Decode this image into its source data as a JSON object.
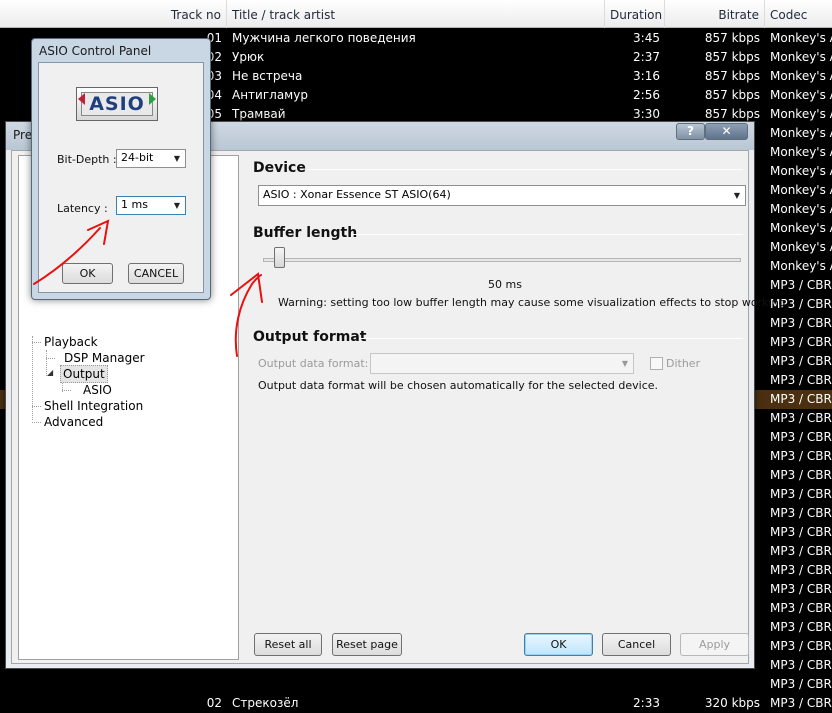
{
  "playlist": {
    "columns": [
      "Track no",
      "Title / track artist",
      "Duration",
      "Bitrate",
      "Codec"
    ],
    "rows": [
      {
        "track": "01",
        "title": "Мужчина легкого поведения",
        "duration": "3:45",
        "bitrate": "857 kbps",
        "codec": "Monkey's A"
      },
      {
        "track": "02",
        "title": "Урюк",
        "duration": "2:37",
        "bitrate": "857 kbps",
        "codec": "Monkey's A"
      },
      {
        "track": "03",
        "title": "Не встреча",
        "duration": "3:16",
        "bitrate": "857 kbps",
        "codec": "Monkey's A"
      },
      {
        "track": "04",
        "title": "Антигламур",
        "duration": "2:56",
        "bitrate": "857 kbps",
        "codec": "Monkey's A"
      },
      {
        "track": "05",
        "title": "Трамвай",
        "duration": "3:30",
        "bitrate": "857 kbps",
        "codec": "Monkey's A"
      },
      {
        "track": "",
        "title": "",
        "duration": "",
        "bitrate": "",
        "codec": "Monkey's A"
      },
      {
        "track": "",
        "title": "",
        "duration": "",
        "bitrate": "",
        "codec": "Monkey's A"
      },
      {
        "track": "",
        "title": "",
        "duration": "",
        "bitrate": "",
        "codec": "Monkey's A"
      },
      {
        "track": "",
        "title": "",
        "duration": "",
        "bitrate": "",
        "codec": "Monkey's A"
      },
      {
        "track": "",
        "title": "",
        "duration": "",
        "bitrate": "",
        "codec": "Monkey's A"
      },
      {
        "track": "",
        "title": "",
        "duration": "",
        "bitrate": "",
        "codec": "Monkey's A"
      },
      {
        "track": "",
        "title": "",
        "duration": "",
        "bitrate": "",
        "codec": "Monkey's A"
      },
      {
        "track": "",
        "title": "",
        "duration": "",
        "bitrate": "",
        "codec": "Monkey's A"
      },
      {
        "track": "",
        "title": "",
        "duration": "",
        "bitrate": "",
        "codec": "MP3 / CBR"
      },
      {
        "track": "",
        "title": "",
        "duration": "",
        "bitrate": "",
        "codec": "MP3 / CBR"
      },
      {
        "track": "",
        "title": "",
        "duration": "",
        "bitrate": "",
        "codec": "MP3 / CBR"
      },
      {
        "track": "",
        "title": "",
        "duration": "",
        "bitrate": "",
        "codec": "MP3 / CBR"
      },
      {
        "track": "",
        "title": "",
        "duration": "",
        "bitrate": "",
        "codec": "MP3 / CBR"
      },
      {
        "track": "",
        "title": "",
        "duration": "",
        "bitrate": "",
        "codec": "MP3 / CBR"
      },
      {
        "track": "",
        "title": "",
        "duration": "",
        "bitrate": "",
        "codec": "MP3 / CBR"
      },
      {
        "track": "",
        "title": "",
        "duration": "",
        "bitrate": "",
        "codec": "MP3 / CBR"
      },
      {
        "track": "",
        "title": "",
        "duration": "",
        "bitrate": "",
        "codec": "MP3 / CBR"
      },
      {
        "track": "",
        "title": "",
        "duration": "",
        "bitrate": "",
        "codec": "MP3 / CBR"
      },
      {
        "track": "",
        "title": "",
        "duration": "",
        "bitrate": "",
        "codec": "MP3 / CBR"
      },
      {
        "track": "",
        "title": "",
        "duration": "",
        "bitrate": "",
        "codec": "MP3 / CBR"
      },
      {
        "track": "",
        "title": "",
        "duration": "",
        "bitrate": "",
        "codec": "MP3 / CBR"
      },
      {
        "track": "",
        "title": "",
        "duration": "",
        "bitrate": "",
        "codec": "MP3 / CBR"
      },
      {
        "track": "",
        "title": "",
        "duration": "",
        "bitrate": "",
        "codec": "MP3 / CBR"
      },
      {
        "track": "",
        "title": "",
        "duration": "",
        "bitrate": "",
        "codec": "MP3 / CBR"
      },
      {
        "track": "",
        "title": "",
        "duration": "",
        "bitrate": "",
        "codec": "MP3 / CBR"
      },
      {
        "track": "",
        "title": "",
        "duration": "",
        "bitrate": "",
        "codec": "MP3 / CBR"
      },
      {
        "track": "",
        "title": "",
        "duration": "",
        "bitrate": "",
        "codec": "MP3 / CBR"
      },
      {
        "track": "",
        "title": "",
        "duration": "",
        "bitrate": "",
        "codec": "MP3 / CBR"
      },
      {
        "track": "",
        "title": "",
        "duration": "",
        "bitrate": "",
        "codec": "MP3 / CBR"
      },
      {
        "track": "",
        "title": "",
        "duration": "",
        "bitrate": "",
        "codec": "MP3 / CBR"
      },
      {
        "track": "02",
        "title": "Стрекозёл",
        "duration": "2:33",
        "bitrate": "320 kbps",
        "codec": "MP3 / CBR"
      }
    ],
    "highlight_row": 19
  },
  "preferences": {
    "title": "Pre",
    "help_symbol": "?",
    "close_symbol": "✕",
    "tree": {
      "items": [
        {
          "label": "Playback",
          "level": 0
        },
        {
          "label": "DSP Manager",
          "level": 1
        },
        {
          "label": "Output",
          "level": 1,
          "selected": true
        },
        {
          "label": "ASIO",
          "level": 2
        },
        {
          "label": "Shell Integration",
          "level": 0
        },
        {
          "label": "Advanced",
          "level": 0
        }
      ]
    },
    "device": {
      "title": "Device",
      "selected": "ASIO : Xonar Essence ST ASIO(64)"
    },
    "buffer": {
      "title": "Buffer length",
      "value_label": "50 ms",
      "position": 0.02,
      "warning": "Warning: setting too low buffer length may cause some visualization effects to stop working."
    },
    "output_format": {
      "title": "Output format",
      "label": "Output data format:",
      "value": "",
      "dither_label": "Dither",
      "note": "Output data format will be chosen automatically for the selected device."
    },
    "buttons": {
      "reset_all": "Reset all",
      "reset_page": "Reset page",
      "ok": "OK",
      "cancel": "Cancel",
      "apply": "Apply"
    }
  },
  "asio_panel": {
    "title": "ASIO Control Panel",
    "logo_text": "ASIO",
    "bit_depth_label": "Bit-Depth :",
    "bit_depth_value": "24-bit",
    "latency_label": "Latency :",
    "latency_value": "1 ms",
    "ok": "OK",
    "cancel": "CANCEL"
  },
  "colors": {
    "annotation": "#e81010",
    "playlist_bg": "#000000",
    "highlight_row": "#4a3010",
    "default_button": "#3c7fb1"
  }
}
